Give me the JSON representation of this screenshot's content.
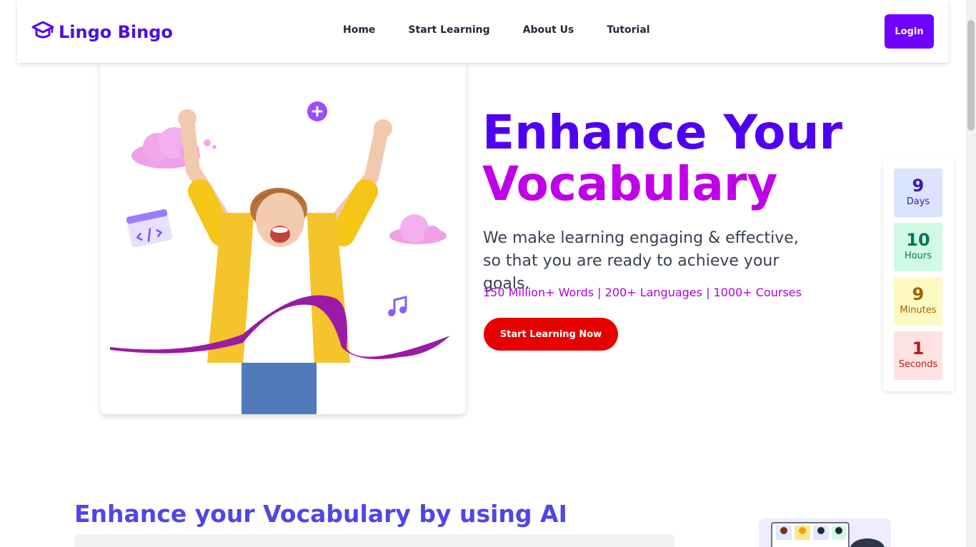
{
  "brand": {
    "name": "Lingo Bingo",
    "accent": "#5000f0"
  },
  "nav": {
    "links": [
      "Home",
      "Start Learning",
      "About Us",
      "Tutorial"
    ],
    "login_label": "Login"
  },
  "hero": {
    "title_line1": "Enhance Your",
    "title_line2": "Vocabulary",
    "subtitle_line1": "We make learning engaging & effective,",
    "subtitle_line2": "so that you are ready to achieve your goals.",
    "stats": "150 Million+ Words | 200+ Languages | 1000+ Courses",
    "cta_label": "Start Learning Now"
  },
  "countdown": [
    {
      "value": "9",
      "label": "Days",
      "bg": "#dbe4ff",
      "fg": "#3b1aa8"
    },
    {
      "value": "10",
      "label": "Hours",
      "bg": "#d1fae5",
      "fg": "#047857"
    },
    {
      "value": "9",
      "label": "Minutes",
      "bg": "#fef9c3",
      "fg": "#a16207"
    },
    {
      "value": "1",
      "label": "Seconds",
      "bg": "#fee2e2",
      "fg": "#b91c1c"
    }
  ],
  "section2": {
    "title": "Enhance your Vocabulary by using AI"
  }
}
